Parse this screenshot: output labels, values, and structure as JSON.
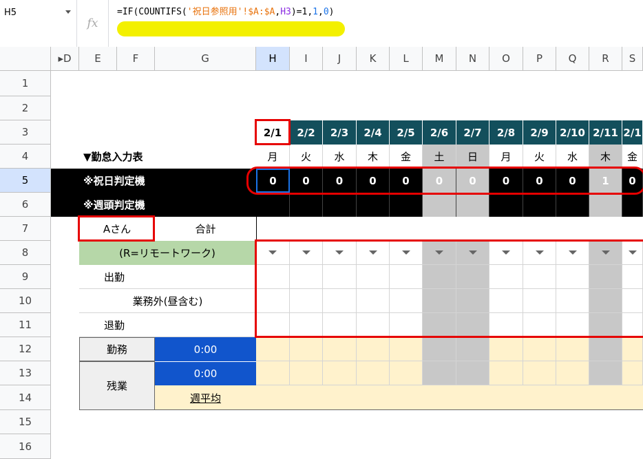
{
  "namebox": "H5",
  "formula": {
    "prefix": "=IF(COUNTIFS(",
    "sheet_ref": "'祝日参照用'!",
    "range": "$A:$A",
    "sep": ",",
    "cell": "H3",
    "suffix": ")=1,",
    "one": "1",
    "comma2": ",",
    "zero": "0",
    "close": ")"
  },
  "fx_icon": "fx",
  "columns": [
    "▸D",
    "E",
    "F",
    "G",
    "H",
    "I",
    "J",
    "K",
    "L",
    "M",
    "N",
    "O",
    "P",
    "Q",
    "R",
    "S"
  ],
  "rows": [
    "1",
    "2",
    "3",
    "4",
    "5",
    "6",
    "7",
    "8",
    "9",
    "10",
    "11",
    "12",
    "13",
    "14",
    "15",
    "16"
  ],
  "dates": [
    "2/1",
    "2/2",
    "2/3",
    "2/4",
    "2/5",
    "2/6",
    "2/7",
    "2/8",
    "2/9",
    "2/10",
    "2/11",
    "2/1"
  ],
  "weekdays": [
    "月",
    "火",
    "水",
    "木",
    "金",
    "土",
    "日",
    "月",
    "火",
    "水",
    "木",
    "金"
  ],
  "holiday_flags": [
    "0",
    "0",
    "0",
    "0",
    "0",
    "0",
    "0",
    "0",
    "0",
    "0",
    "1",
    "0"
  ],
  "gray_days": [
    false,
    false,
    false,
    false,
    false,
    true,
    true,
    false,
    false,
    false,
    true,
    false
  ],
  "labels": {
    "attendance_table": "▼勤怠入力表",
    "holiday_judge": "※祝日判定機",
    "week_start_judge": "※週頭判定機",
    "person": "Aさん",
    "total": "合計",
    "remote_note": "(R=リモートワーク)",
    "clock_in": "出勤",
    "out_of_work": "業務外(昼含む)",
    "clock_out": "退勤",
    "work": "勤務",
    "overtime": "残業",
    "work_total": "0:00",
    "overtime_total": "0:00",
    "weekly_avg": "週平均"
  },
  "colors": {
    "date_header": "#134f5c",
    "highlight": "#e60000",
    "formula_highlight": "#f3f000",
    "blue_cell": "#1155cc",
    "green_cell": "#b6d7a8",
    "yellow_cell": "#fff2cc",
    "gray_cell": "#c8c8c8"
  }
}
